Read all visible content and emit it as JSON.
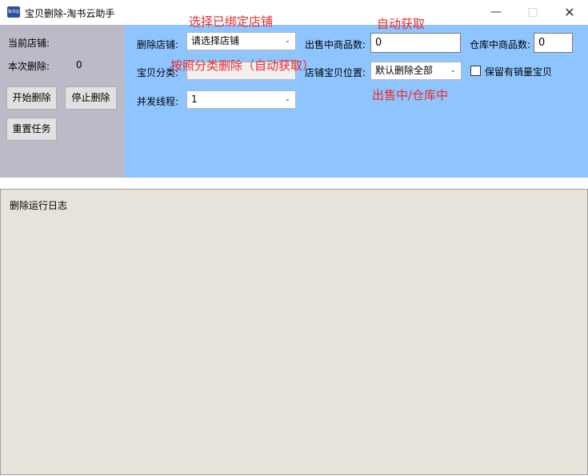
{
  "window": {
    "title": "宝贝删除-淘书云助手",
    "icon_text": "淘书云"
  },
  "left_panel": {
    "current_store_label": "当前店铺:",
    "current_store_value": "",
    "deleted_count_label": "本次删除:",
    "deleted_count_value": "0",
    "start_button": "开始删除",
    "stop_button": "停止删除",
    "reset_button": "重置任务"
  },
  "form": {
    "delete_store_label": "删除店铺:",
    "delete_store_value": "请选择店铺",
    "category_label": "宝贝分类:",
    "category_value": "",
    "threads_label": "并发线程:",
    "threads_value": "1",
    "on_sale_label": "出售中商品数:",
    "on_sale_value": "0",
    "warehouse_label": "仓库中商品数:",
    "warehouse_value": "0",
    "position_label": "店铺宝贝位置:",
    "position_value": "默认删除全部",
    "keep_sales_label": "保留有销量宝贝",
    "keep_sales_checked": false
  },
  "annotations": {
    "select_store": "选择已绑定店铺",
    "by_category": "按照分类删除（自动获取）",
    "auto_fetch": "自动获取",
    "on_sale_warehouse": "出售中/仓库中"
  },
  "log": {
    "title": "删除运行日志"
  },
  "colors": {
    "left_panel": "#bcbac7",
    "blue_panel": "#8ec5ff",
    "log_panel": "#e6e3da",
    "annotation": "#ee2a2a"
  }
}
